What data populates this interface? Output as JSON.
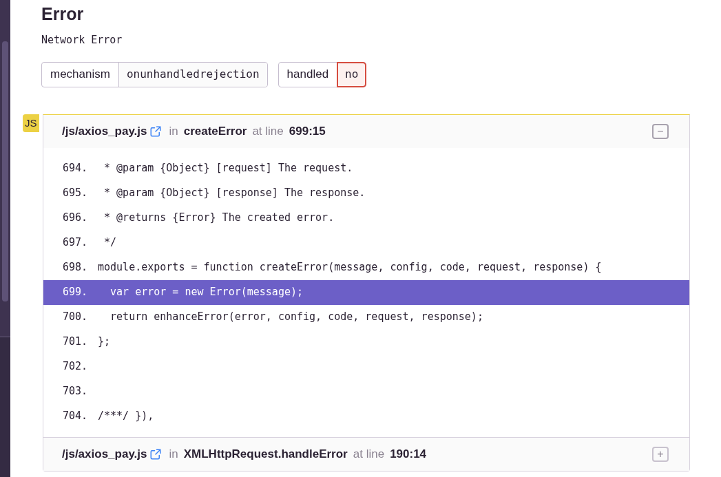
{
  "title": "Error",
  "message": "Network Error",
  "tags": [
    {
      "key": "mechanism",
      "value": "onunhandledrejection",
      "alert": false
    },
    {
      "key": "handled",
      "value": "no",
      "alert": true
    }
  ],
  "platform_badge": "JS",
  "frames": [
    {
      "file": "/js/axios_pay.js",
      "in": "in",
      "function": "createError",
      "at": "at line",
      "line": "699:15",
      "expanded": true,
      "toggle_symbol": "−",
      "code": [
        {
          "number": "694.",
          "text": " * @param {Object} [request] The request.",
          "selected": false
        },
        {
          "number": "695.",
          "text": " * @param {Object} [response] The response.",
          "selected": false
        },
        {
          "number": "696.",
          "text": " * @returns {Error} The created error.",
          "selected": false
        },
        {
          "number": "697.",
          "text": " */",
          "selected": false
        },
        {
          "number": "698.",
          "text": "module.exports = function createError(message, config, code, request, response) {",
          "selected": false
        },
        {
          "number": "699.",
          "text": "  var error = new Error(message);",
          "selected": true
        },
        {
          "number": "700.",
          "text": "  return enhanceError(error, config, code, request, response);",
          "selected": false
        },
        {
          "number": "701.",
          "text": "};",
          "selected": false
        },
        {
          "number": "702.",
          "selected": false
        },
        {
          "number": "703.",
          "selected": false
        },
        {
          "number": "704.",
          "text": "/***/ }),",
          "selected": false
        }
      ]
    },
    {
      "file": "/js/axios_pay.js",
      "in": "in",
      "function": "XMLHttpRequest.handleError",
      "at": "at line",
      "line": "190:14",
      "expanded": false,
      "toggle_symbol": "+"
    }
  ]
}
